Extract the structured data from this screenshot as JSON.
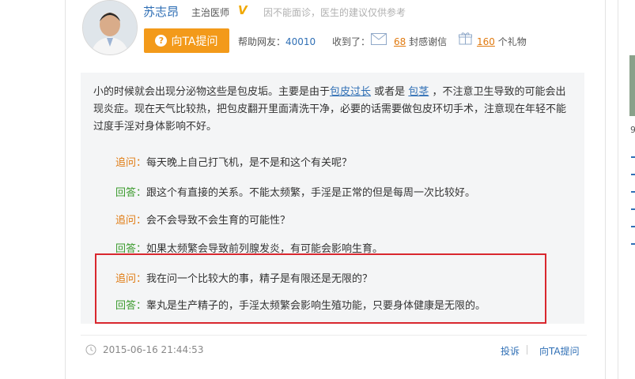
{
  "doctor": {
    "name": "苏志昂",
    "title": "主治医师",
    "verified_badge": "V",
    "notice": "因不能面诊，医生的建议仅供参考",
    "ask_button": "向TA提问",
    "help_label": "帮助网友：",
    "help_count": "40010",
    "received_label": "收到了：",
    "thanks_count": "68",
    "thanks_label": "封感谢信",
    "gift_count": "160",
    "gift_label": "个礼物"
  },
  "answer": {
    "part1": "小的时候就会出现分泌物这些是包皮垢。主要是由于",
    "link1": "包皮过长",
    "part2": "或者是",
    "link2": "包茎",
    "part3": "，不注意卫生导致的可能会出现炎症。现在天气比较热，把包皮翻开里面清洗干净，必要的话需要做包皮环切手术，注意现在年轻不能过度手淫对身体影响不好。"
  },
  "qa": [
    {
      "label": "追问：",
      "text": "每天晚上自己打飞机，是不是和这个有关呢？"
    },
    {
      "label": "回答：",
      "text": "跟这个有直接的关系。不能太频繁，手淫是正常的但是每周一次比较好。"
    },
    {
      "label": "追问：",
      "text": "会不会导致不会生育的可能性？"
    },
    {
      "label": "回答：",
      "text": "如果太频繁会导致前列腺发炎，有可能会影响生育。"
    },
    {
      "label": "追问：",
      "text": "我在问一个比较大的事，精子是有限还是无限的？"
    },
    {
      "label": "回答：",
      "text": "睾丸是生产精子的，手淫太频繁会影响生殖功能，只要身体健康是无限的。"
    }
  ],
  "footer": {
    "timestamp": "2015-06-16 21:44:53",
    "report": "投诉",
    "ask": "向TA提问"
  },
  "rail": {
    "partial_text": "9"
  },
  "colors": {
    "accent_orange": "#f39a1a",
    "link_blue": "#2f6fb5",
    "followup_orange": "#e07a10",
    "reply_green": "#3a9a2c",
    "highlight_red": "#d9272e"
  }
}
